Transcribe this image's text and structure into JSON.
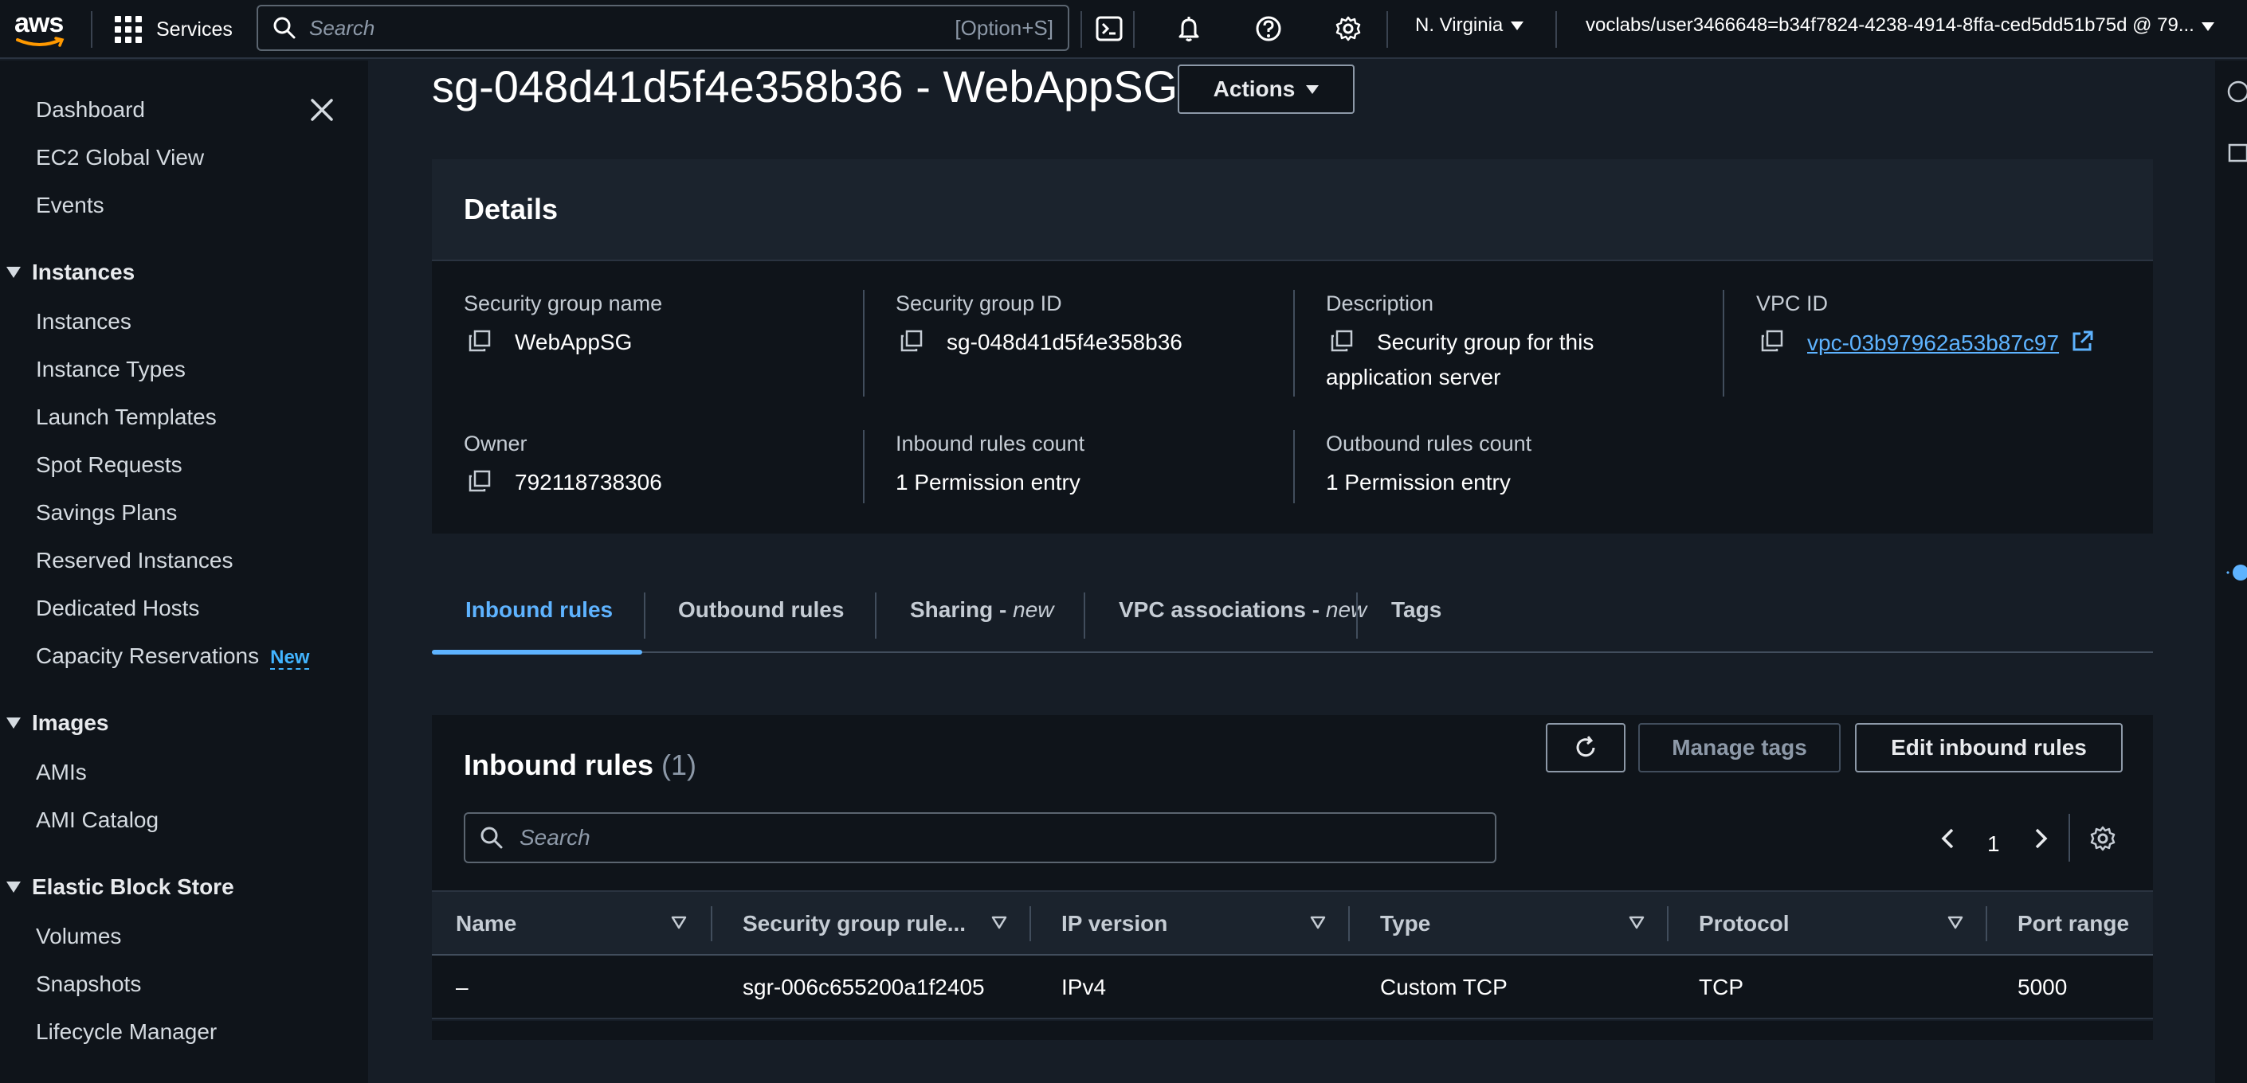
{
  "topnav": {
    "logo_text": "aws",
    "services_label": "Services",
    "search_placeholder": "Search",
    "search_shortcut": "[Option+S]",
    "region": "N. Virginia",
    "account": "voclabs/user3466648=b34f7824-4238-4914-8ffa-ced5dd51b75d @ 79..."
  },
  "sidebar": {
    "items_top": [
      {
        "label": "Dashboard"
      },
      {
        "label": "EC2 Global View"
      },
      {
        "label": "Events"
      }
    ],
    "sections": [
      {
        "title": "Instances",
        "items": [
          {
            "label": "Instances"
          },
          {
            "label": "Instance Types"
          },
          {
            "label": "Launch Templates"
          },
          {
            "label": "Spot Requests"
          },
          {
            "label": "Savings Plans"
          },
          {
            "label": "Reserved Instances"
          },
          {
            "label": "Dedicated Hosts"
          },
          {
            "label": "Capacity Reservations",
            "badge": "New"
          }
        ]
      },
      {
        "title": "Images",
        "items": [
          {
            "label": "AMIs"
          },
          {
            "label": "AMI Catalog"
          }
        ]
      },
      {
        "title": "Elastic Block Store",
        "items": [
          {
            "label": "Volumes"
          },
          {
            "label": "Snapshots"
          },
          {
            "label": "Lifecycle Manager"
          }
        ]
      }
    ]
  },
  "page": {
    "title": "sg-048d41d5f4e358b36 - WebAppSG",
    "actions_label": "Actions"
  },
  "details": {
    "heading": "Details",
    "fields": {
      "sg_name_label": "Security group name",
      "sg_name": "WebAppSG",
      "sg_id_label": "Security group ID",
      "sg_id": "sg-048d41d5f4e358b36",
      "description_label": "Description",
      "description_line1": "Security group for this",
      "description_line2": "application server",
      "vpc_label": "VPC ID",
      "vpc_id": "vpc-03b97962a53b87c97",
      "owner_label": "Owner",
      "owner": "792118738306",
      "inbound_count_label": "Inbound rules count",
      "inbound_count": "1 Permission entry",
      "outbound_count_label": "Outbound rules count",
      "outbound_count": "1 Permission entry"
    }
  },
  "tabs": [
    {
      "label": "Inbound rules",
      "suffix": ""
    },
    {
      "label": "Outbound rules",
      "suffix": ""
    },
    {
      "label": "Sharing - ",
      "suffix": "new"
    },
    {
      "label": "VPC associations - ",
      "suffix": "new"
    },
    {
      "label": "Tags",
      "suffix": ""
    }
  ],
  "inbound": {
    "title": "Inbound rules",
    "count": "(1)",
    "manage_tags_label": "Manage tags",
    "edit_label": "Edit inbound rules",
    "search_placeholder": "Search",
    "page_number": "1",
    "columns": [
      "Name",
      "Security group rule...",
      "IP version",
      "Type",
      "Protocol",
      "Port range"
    ],
    "rows": [
      [
        "–",
        "sgr-006c655200a1f2405",
        "IPv4",
        "Custom TCP",
        "TCP",
        "5000"
      ]
    ]
  },
  "colors": {
    "accent": "#5eb3ff",
    "background": "#161d26",
    "panel": "#0f141a"
  }
}
